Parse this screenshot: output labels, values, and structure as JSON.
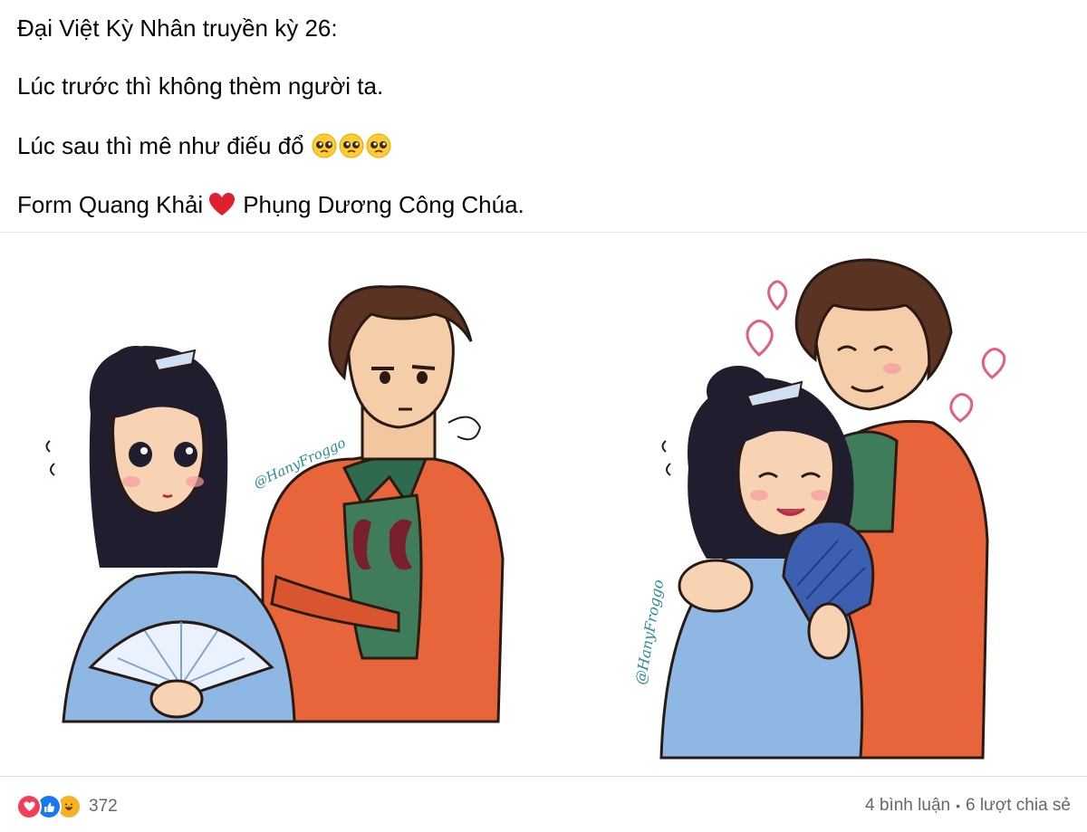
{
  "post": {
    "lines": [
      "Đại Việt Kỳ Nhân truyền kỳ 26:",
      "Lúc trước thì không thèm người ta.",
      "Lúc sau thì mê như điếu đổ",
      "Form Quang Khải",
      "Phụng Dương Công  Chúa."
    ],
    "emojis_line3": [
      "pleading-face",
      "pleading-face",
      "pleading-face"
    ],
    "heart_emoji": "red-heart"
  },
  "image": {
    "watermark_left": "@HanyFroggo",
    "watermark_right": "@HanyFroggo"
  },
  "footer": {
    "reaction_icons": [
      "love",
      "like",
      "haha"
    ],
    "reaction_count": "372",
    "comments": "4 bình luận",
    "separator": "•",
    "shares": "6 lượt chia sẻ"
  },
  "colors": {
    "love": "#f33e58",
    "like": "#1877f2",
    "haha": "#f7b125",
    "robe_orange": "#e8643a",
    "robe_blue": "#8fb7e3",
    "hair": "#1f1d2e",
    "hair_brown": "#5a3322"
  }
}
